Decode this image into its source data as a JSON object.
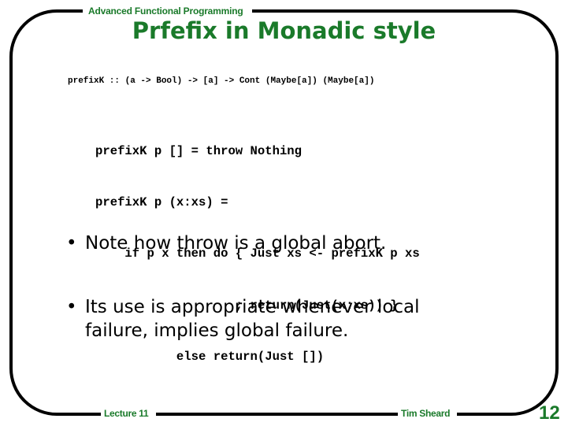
{
  "header": {
    "course": "Advanced Functional Programming",
    "title": "Prfefix in Monadic style"
  },
  "signature": "prefixK :: (a -> Bool) -> [a] -> Cont (Maybe[a]) (Maybe[a])",
  "code_lines": [
    "prefixK p [] = throw Nothing",
    "prefixK p (x:xs) =",
    "    if p x then do { Just xs <- prefixK p xs",
    "                   ; return(Just(x:xs)) }",
    "           else return(Just [])"
  ],
  "bullets": [
    {
      "marker": "•",
      "text": "Note how throw is a global abort."
    },
    {
      "marker": "•",
      "text": "Its use is appropriate whenever local failure, implies global failure."
    }
  ],
  "footer": {
    "left": "Lecture 11",
    "right": "Tim Sheard",
    "page_number": "12"
  },
  "colors": {
    "accent_green": "#1a7a2a",
    "frame": "#000000",
    "text": "#000000"
  }
}
